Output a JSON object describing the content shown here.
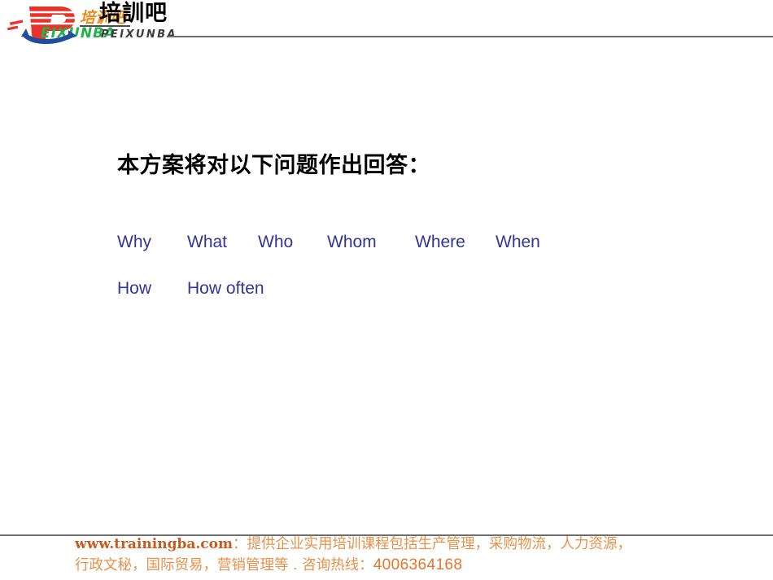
{
  "header": {
    "logo": {
      "mark_name": "peixunba-logo-mark",
      "letter": "P",
      "script_cn": "培训吧",
      "romanization": "PEIXUNBA",
      "colors": {
        "p_red": "#e8322a",
        "script_orange": "#f08a1e",
        "romanization_green": "#22b14c",
        "swoosh_blue": "#1f4e9c"
      }
    },
    "title_cn": "培訓吧",
    "title_pinyin": "PEIXUNBA",
    "rule_color": "#6e6e6e"
  },
  "main": {
    "heading": "本方案将对以下问题作出回答：",
    "question_rows": [
      [
        "Why",
        "What",
        "Who",
        "Whom",
        "Where",
        "When"
      ],
      [
        "How",
        "How often"
      ]
    ],
    "question_color": "#333399"
  },
  "footer": {
    "url": "www.trainingba.com",
    "colon_1": "：",
    "description_1": "提供企业实用培训课程包括生产管理，采购物流，人力资源，",
    "description_2": "行政文秘，国际贸易，营销管理等 . 咨询热线：",
    "phone": "4006364168",
    "text_color": "#e8914a",
    "url_color": "#c75b1e",
    "phone_color": "#e8752a",
    "rule_color": "#6e6e6e"
  }
}
